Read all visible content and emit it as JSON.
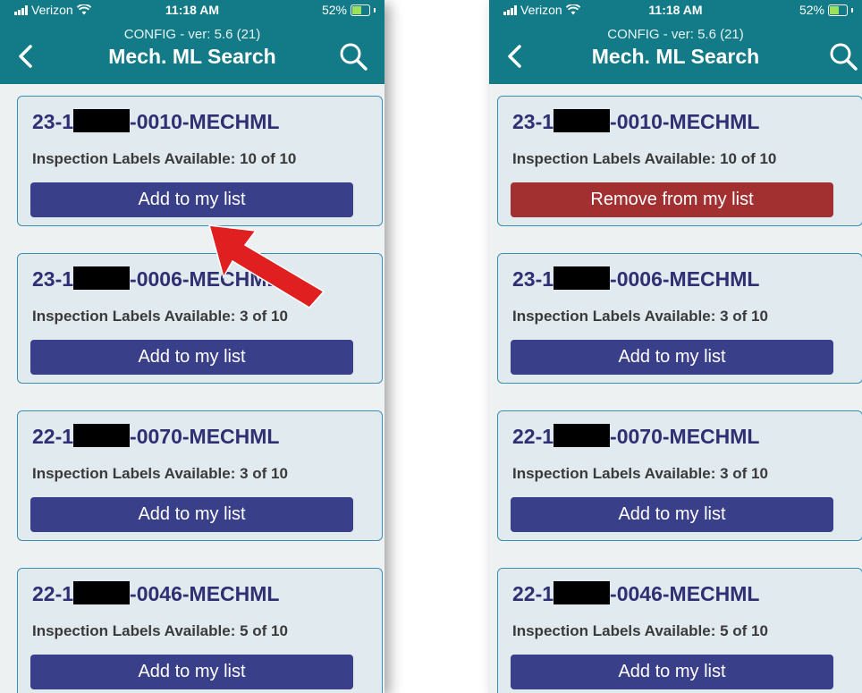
{
  "screens": [
    {
      "status": {
        "carrier": "Verizon",
        "time": "11:18 AM",
        "battery": "52%"
      },
      "header": {
        "config": "CONFIG - ver: 5.6 (21)",
        "title": "Mech. ML Search"
      },
      "cards": [
        {
          "prefix": "23-1",
          "suffix": "-0010-MECHML",
          "labels": "Inspection Labels Available: 10 of 10",
          "button": "Add to my list"
        },
        {
          "prefix": "23-1",
          "suffix": "-0006-MECHML",
          "labels": "Inspection Labels Available: 3 of 10",
          "button": "Add to my list"
        },
        {
          "prefix": "22-1",
          "suffix": "-0070-MECHML",
          "labels": "Inspection Labels Available: 3 of 10",
          "button": "Add to my list"
        },
        {
          "prefix": "22-1",
          "suffix": "-0046-MECHML",
          "labels": "Inspection Labels Available: 5 of 10",
          "button": "Add to my list"
        }
      ]
    },
    {
      "status": {
        "carrier": "Verizon",
        "time": "11:18 AM",
        "battery": "52%"
      },
      "header": {
        "config": "CONFIG - ver: 5.6 (21)",
        "title": "Mech. ML Search"
      },
      "cards": [
        {
          "prefix": "23-1",
          "suffix": "-0010-MECHML",
          "labels": "Inspection Labels Available: 10 of 10",
          "button": "Remove from my list"
        },
        {
          "prefix": "23-1",
          "suffix": "-0006-MECHML",
          "labels": "Inspection Labels Available: 3 of 10",
          "button": "Add to my list"
        },
        {
          "prefix": "22-1",
          "suffix": "-0070-MECHML",
          "labels": "Inspection Labels Available: 3 of 10",
          "button": "Add to my list"
        },
        {
          "prefix": "22-1",
          "suffix": "-0046-MECHML",
          "labels": "Inspection Labels Available: 5 of 10",
          "button": "Add to my list"
        }
      ]
    }
  ],
  "colors": {
    "header": "#127b87",
    "card_bg": "#e1eaef",
    "card_border": "#3b8fb0",
    "add_button": "#3a3f8a",
    "remove_button": "#a33030",
    "annotation_arrow": "#e02020"
  },
  "icons": [
    "signal-icon",
    "wifi-icon",
    "battery-icon",
    "back-chevron-icon",
    "search-icon",
    "redaction-bar",
    "annotation-arrow"
  ],
  "battery_level": 0.52
}
